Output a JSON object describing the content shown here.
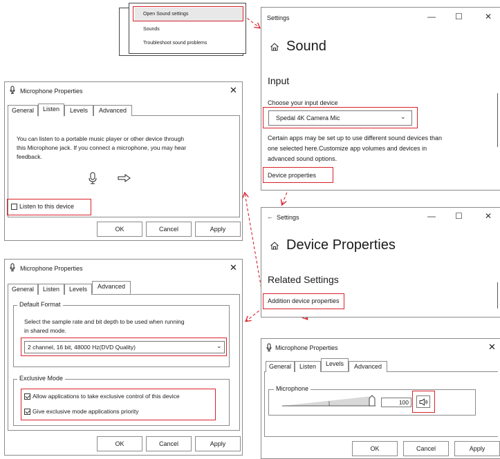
{
  "context_menu": {
    "items": [
      "Open Sound settings",
      "Sounds",
      "Troubleshoot sound problems"
    ]
  },
  "settings_sound": {
    "window_title": "Settings",
    "page_title": "Sound",
    "section_input": "Input",
    "choose_label": "Choose your input device",
    "device_selected": "Spedal 4K Camera Mic",
    "info_text_1": "Certain apps may be set up to use different sound devices than",
    "info_text_2": "one selected here.Customize app volumes and devices in",
    "info_text_3": "advanced sound options.",
    "device_properties_link": "Device properties",
    "controls": {
      "minimize": "—",
      "maximize": "☐",
      "close": "✕"
    }
  },
  "settings_device": {
    "window_title": "Settings",
    "back_glyph": "←",
    "page_title": "Device Properties",
    "section_related": "Related Settings",
    "addition_link": "Addition device properties",
    "controls": {
      "minimize": "—",
      "maximize": "☐",
      "close": "✕"
    }
  },
  "mic_listen": {
    "title": "Microphone Properties",
    "tabs": [
      "General",
      "Listen",
      "Levels",
      "Advanced"
    ],
    "text_1": "You can listen to a portable music player or other device through",
    "text_2": "this Microphone jack. If you connect a microphone, you may hear",
    "text_3": "feedback.",
    "checkbox_label": "Listen to this device",
    "buttons": {
      "ok": "OK",
      "cancel": "Cancel",
      "apply": "Apply"
    }
  },
  "mic_advanced": {
    "title": "Microphone Properties",
    "tabs": [
      "General",
      "Listen",
      "Levels",
      "Advanced"
    ],
    "default_format_title": "Default Format",
    "default_format_desc_1": "Select the sample rate and bit depth to be used when running",
    "default_format_desc_2": "in shared mode.",
    "format_selected": "2 channel, 16 bit,  48000 Hz(DVD Quality)",
    "exclusive_title": "Exclusive Mode",
    "exclusive_opt_1": "Allow applications to take exclusive control of this device",
    "exclusive_opt_2": "Give exclusive mode applications priority",
    "buttons": {
      "ok": "OK",
      "cancel": "Cancel",
      "apply": "Apply"
    }
  },
  "mic_levels": {
    "title": "Microphone Properties",
    "tabs": [
      "General",
      "Listen",
      "Levels",
      "Advanced"
    ],
    "group_title": "Microphone",
    "level_value": "100",
    "level_fraction": 1.0,
    "buttons": {
      "ok": "OK",
      "cancel": "Cancel",
      "apply": "Apply"
    }
  },
  "colors": {
    "highlight_red": "#d9202a",
    "border_gray": "#8a8a8a"
  }
}
